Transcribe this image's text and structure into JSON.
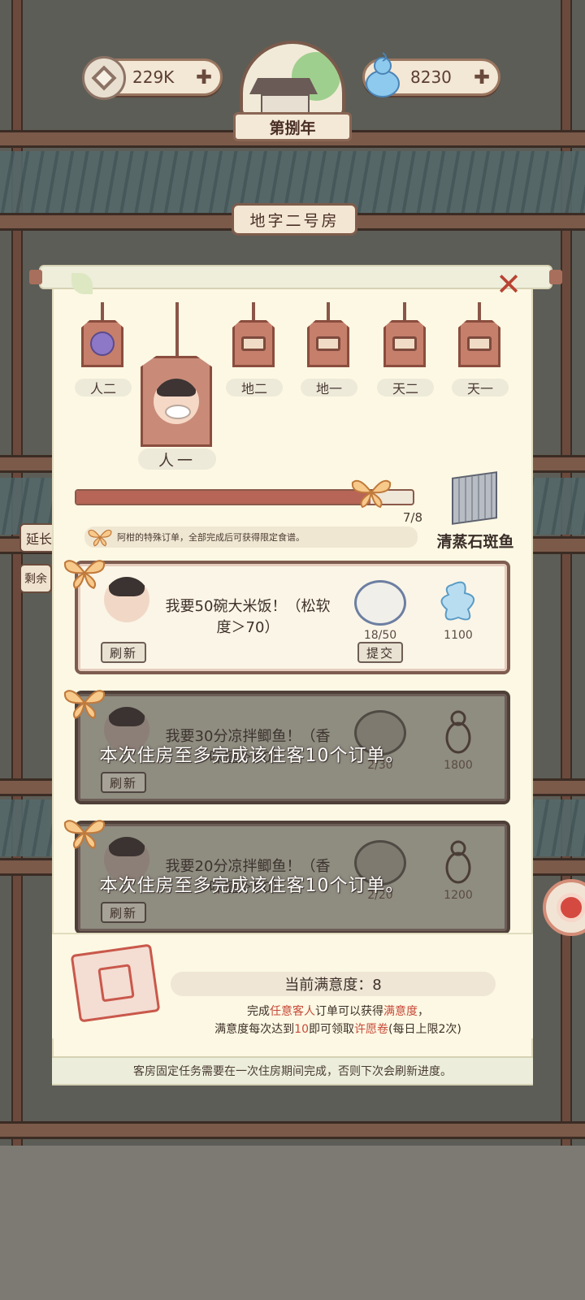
{
  "hud": {
    "coins": "229K",
    "gems": "8230",
    "year": "第捌年",
    "room_name": "地字二号房",
    "side_signs": [
      "延长",
      "剩余"
    ]
  },
  "guests": {
    "selected_label": "人一",
    "tags": [
      {
        "label": "人二",
        "state": "unlocked",
        "icon": "onion-icon"
      },
      {
        "label": "地二",
        "state": "locked",
        "icon": "lock-icon"
      },
      {
        "label": "地一",
        "state": "locked",
        "icon": "lock-icon"
      },
      {
        "label": "天二",
        "state": "locked",
        "icon": "lock-icon"
      },
      {
        "label": "天一",
        "state": "locked",
        "icon": "lock-icon"
      }
    ]
  },
  "special_order": {
    "progress_text": "7/8",
    "progress_fraction": 0.875,
    "note": "阿柑的特殊订单，全部完成后可获得限定食谱。",
    "reward_name": "清蒸石斑鱼"
  },
  "orders": [
    {
      "text": "我要50碗大米饭！（松软度＞70）",
      "progress": "18/50",
      "reward": "1100",
      "refresh_label": "刷新",
      "submit_label": "提交",
      "locked": false
    },
    {
      "text": "我要30分凉拌鲫鱼！（香味值＞60）",
      "progress": "2/30",
      "reward": "1800",
      "refresh_label": "刷新",
      "locked": true
    },
    {
      "text": "我要20分凉拌鲫鱼！（香味值＞50）",
      "progress": "2/20",
      "reward": "1200",
      "refresh_label": "刷新",
      "locked": true
    }
  ],
  "limit_message": "本次住房至多完成该住客10个订单。",
  "satisfaction": {
    "current_label": "当前满意度：8",
    "line1_a": "完成",
    "line1_hl1": "任意客人",
    "line1_b": "订单可以获得",
    "line1_hl2": "满意度",
    "line1_c": "，",
    "line2_a": "满意度每次达到",
    "line2_hl1": "10",
    "line2_b": "即可领取",
    "line2_hl2": "许愿卷",
    "line2_c": "(每日上限2次)"
  },
  "footer_note": "客房固定任务需要在一次住房期间完成，否则下次会刷新进度。",
  "colors": {
    "panel": "#fcf8e3",
    "accent": "#b76556",
    "highlight": "#c74a3a"
  }
}
